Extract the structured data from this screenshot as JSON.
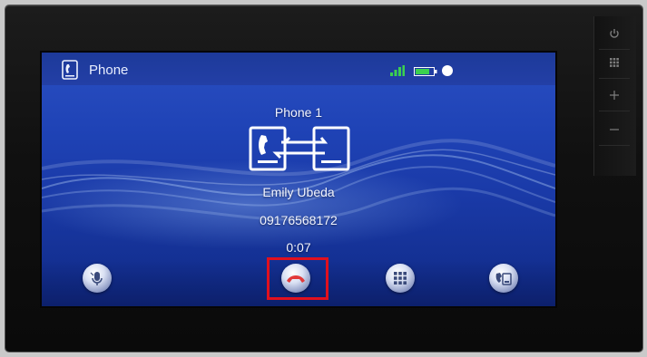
{
  "header": {
    "app_title": "Phone",
    "app_icon": "phone-app-icon",
    "status_icons": [
      "signal-icon",
      "battery-icon",
      "bluetooth-icon"
    ]
  },
  "call": {
    "device_label": "Phone 1",
    "transfer_icon": "call-transfer-icon",
    "caller_name": "Emily Ubeda",
    "caller_number": "09176568172",
    "duration": "0:07"
  },
  "controls": [
    {
      "name": "mute-button",
      "icon": "microphone-icon"
    },
    {
      "name": "end-call-button",
      "icon": "hang-up-icon",
      "highlighted": true
    },
    {
      "name": "keypad-button",
      "icon": "keypad-icon"
    },
    {
      "name": "switch-audio-button",
      "icon": "phone-transfer-icon"
    }
  ],
  "hardware": {
    "buttons": [
      "power-icon",
      "menu-grid-icon",
      "volume-up-icon",
      "volume-down-icon"
    ]
  },
  "colors": {
    "screen_blue": "#1f43b6",
    "highlight": "#e1101e",
    "hangup_red": "#e23a3a"
  }
}
